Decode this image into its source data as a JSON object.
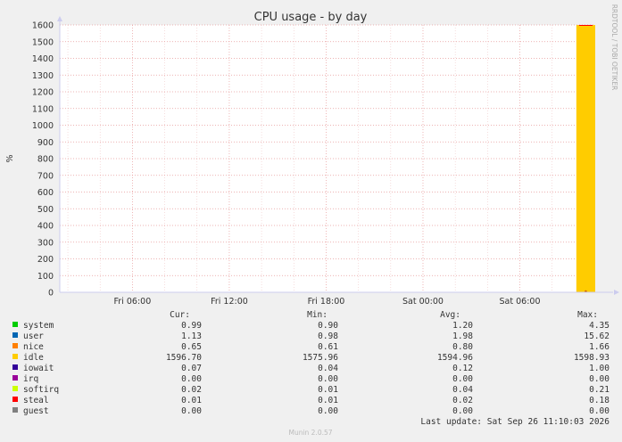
{
  "chart_data": {
    "type": "area",
    "title": "CPU usage - by day",
    "ylabel": "%",
    "side_label": "RRDTOOL / TOBI OETIKER",
    "ylim": [
      0,
      1600
    ],
    "yticks": [
      0,
      100,
      200,
      300,
      400,
      500,
      600,
      700,
      800,
      900,
      1000,
      1100,
      1200,
      1300,
      1400,
      1500,
      1600
    ],
    "xlim": [
      "Fri 01:30",
      "Sat 11:10"
    ],
    "xticks": [
      {
        "label": "Fri 06:00",
        "hours": 6
      },
      {
        "label": "Fri 12:00",
        "hours": 12
      },
      {
        "label": "Fri 18:00",
        "hours": 18
      },
      {
        "label": "Sat 00:00",
        "hours": 24
      },
      {
        "label": "Sat 06:00",
        "hours": 30
      }
    ],
    "grid": true,
    "x_hours": [
      33.5,
      34.7
    ],
    "series": [
      {
        "name": "system",
        "color": "#00cc00",
        "values": [
          0.99,
          0.99
        ]
      },
      {
        "name": "user",
        "color": "#0066b3",
        "values": [
          1.13,
          1.13
        ]
      },
      {
        "name": "nice",
        "color": "#ff8000",
        "values": [
          0.65,
          0.65
        ]
      },
      {
        "name": "idle",
        "color": "#ffcc00",
        "values": [
          1596.7,
          1596.7
        ]
      },
      {
        "name": "iowait",
        "color": "#330099",
        "values": [
          0.07,
          0.07
        ]
      },
      {
        "name": "irq",
        "color": "#990099",
        "values": [
          0.0,
          0.0
        ]
      },
      {
        "name": "softirq",
        "color": "#ccff00",
        "values": [
          0.02,
          0.02
        ]
      },
      {
        "name": "steal",
        "color": "#ff0000",
        "values": [
          0.01,
          0.01
        ]
      },
      {
        "name": "guest",
        "color": "#808080",
        "values": [
          0.0,
          0.0
        ]
      }
    ],
    "legend": {
      "headers": {
        "cur": "Cur:",
        "min": "Min:",
        "avg": "Avg:",
        "max": "Max:"
      },
      "rows": [
        {
          "name": "system",
          "color": "#00cc00",
          "cur": "0.99",
          "min": "0.90",
          "avg": "1.20",
          "max": "4.35"
        },
        {
          "name": "user",
          "color": "#0066b3",
          "cur": "1.13",
          "min": "0.98",
          "avg": "1.98",
          "max": "15.62"
        },
        {
          "name": "nice",
          "color": "#ff8000",
          "cur": "0.65",
          "min": "0.61",
          "avg": "0.80",
          "max": "1.66"
        },
        {
          "name": "idle",
          "color": "#ffcc00",
          "cur": "1596.70",
          "min": "1575.96",
          "avg": "1594.96",
          "max": "1598.93"
        },
        {
          "name": "iowait",
          "color": "#330099",
          "cur": "0.07",
          "min": "0.04",
          "avg": "0.12",
          "max": "1.00"
        },
        {
          "name": "irq",
          "color": "#990099",
          "cur": "0.00",
          "min": "0.00",
          "avg": "0.00",
          "max": "0.00"
        },
        {
          "name": "softirq",
          "color": "#ccff00",
          "cur": "0.02",
          "min": "0.01",
          "avg": "0.04",
          "max": "0.21"
        },
        {
          "name": "steal",
          "color": "#ff0000",
          "cur": "0.01",
          "min": "0.01",
          "avg": "0.02",
          "max": "0.18"
        },
        {
          "name": "guest",
          "color": "#808080",
          "cur": "0.00",
          "min": "0.00",
          "avg": "0.00",
          "max": "0.00"
        }
      ]
    },
    "last_update": "Last update: Sat Sep 26 11:10:03 2026",
    "footer": "Munin 2.0.57"
  }
}
